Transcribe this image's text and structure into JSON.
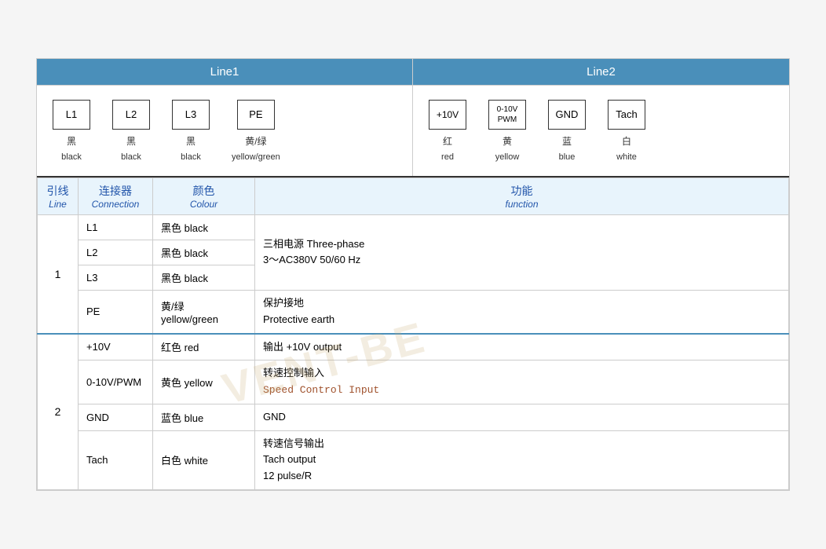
{
  "header": {
    "line1_label": "Line1",
    "line2_label": "Line2"
  },
  "line1_wires": [
    {
      "id": "L1",
      "cn": "黑",
      "en": "black"
    },
    {
      "id": "L2",
      "cn": "黑",
      "en": "black"
    },
    {
      "id": "L3",
      "cn": "黑",
      "en": "black"
    },
    {
      "id": "PE",
      "cn": "黄/绿",
      "en": "yellow/green"
    }
  ],
  "line2_wires": [
    {
      "id": "+10V",
      "cn": "红",
      "en": "red"
    },
    {
      "id": "0-10V\nPWM",
      "cn": "黄",
      "en": "yellow"
    },
    {
      "id": "GND",
      "cn": "蓝",
      "en": "blue"
    },
    {
      "id": "Tach",
      "cn": "白",
      "en": "white"
    }
  ],
  "table_headers": {
    "line_cn": "引线",
    "line_en": "Line",
    "conn_cn": "连接器",
    "conn_en": "Connection",
    "color_cn": "颜色",
    "color_en": "Colour",
    "func_cn": "功能",
    "func_en": "function"
  },
  "rows": [
    {
      "line_num": "1",
      "rowspan": 4,
      "entries": [
        {
          "conn": "L1",
          "color": "黑色 black",
          "func": "三相电源 Three-phase\n3～AC380V 50/60 Hz",
          "func_rowspan": 3
        },
        {
          "conn": "L2",
          "color": "黑色 black",
          "func": null
        },
        {
          "conn": "L3",
          "color": "黑色 black",
          "func": null
        },
        {
          "conn": "PE",
          "color": "黄/绿\nyellow/green",
          "func": "保护接地\nProtective earth",
          "func_rowspan": 1
        }
      ]
    },
    {
      "line_num": "2",
      "rowspan": 4,
      "entries": [
        {
          "conn": "+10V",
          "color": "红色 red",
          "func": "输出 +10V output",
          "func_rowspan": 1
        },
        {
          "conn": "0-10V/PWM",
          "color": "黄色 yellow",
          "func_cn": "转速控制输入",
          "func_en": "Speed Control Input",
          "is_code": true,
          "func_rowspan": 1
        },
        {
          "conn": "GND",
          "color": "蓝色 blue",
          "func": "GND",
          "func_rowspan": 1
        },
        {
          "conn": "Tach",
          "color": "白色 white",
          "func": "转速信号输出\nTach output\n12 pulse/R",
          "func_rowspan": 1
        }
      ]
    }
  ],
  "watermark": "VENT-BE"
}
